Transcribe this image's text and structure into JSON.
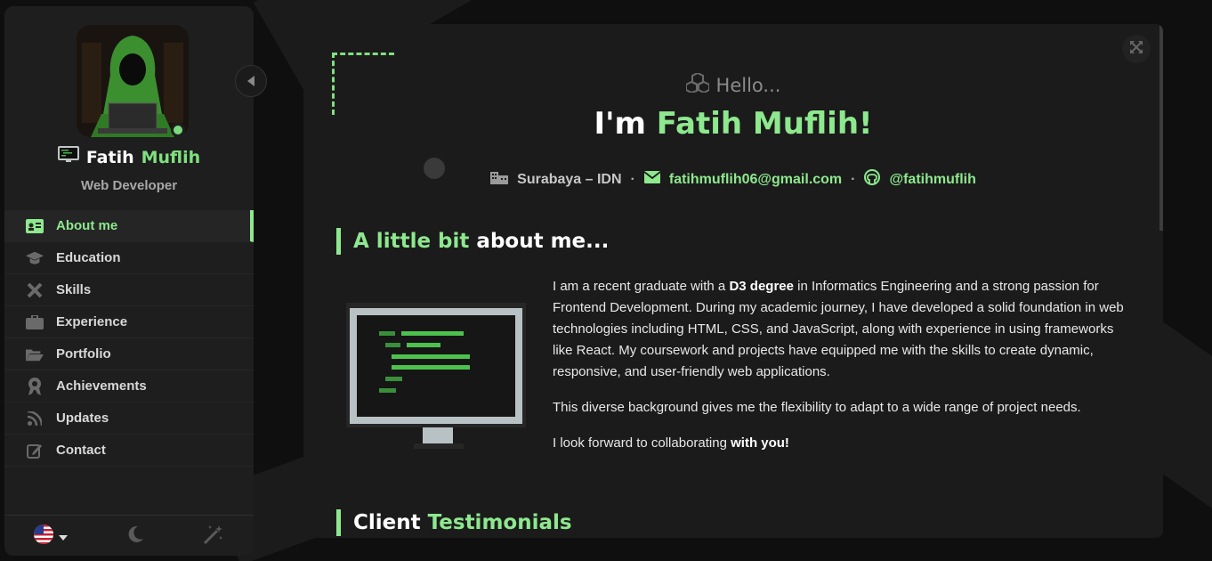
{
  "sidebar": {
    "name_first": "Fatih",
    "name_last": "Muflih",
    "role": "Web Developer",
    "nav": [
      {
        "label": "About me",
        "icon": "id-card-icon",
        "active": true
      },
      {
        "label": "Education",
        "icon": "graduation-cap-icon"
      },
      {
        "label": "Skills",
        "icon": "tools-icon"
      },
      {
        "label": "Experience",
        "icon": "briefcase-icon"
      },
      {
        "label": "Portfolio",
        "icon": "folder-open-icon"
      },
      {
        "label": "Achievements",
        "icon": "award-icon"
      },
      {
        "label": "Updates",
        "icon": "rss-icon"
      },
      {
        "label": "Contact",
        "icon": "edit-icon"
      }
    ],
    "footer": [
      "us-flag-icon",
      "moon-icon",
      "magic-wand-icon"
    ]
  },
  "main": {
    "hello": "Hello...",
    "headline_prefix": "I'm",
    "headline_name": "Fatih Muflih!",
    "location": "Surabaya – IDN",
    "email": "fatihmuflih06@gmail.com",
    "github": "@fatihmuflih",
    "separator": "·",
    "about_title_accent": "A little bit",
    "about_title_rest": "about me...",
    "about_p1_a": "I am a recent graduate with a",
    "about_p1_bold": "D3 degree",
    "about_p1_b": "in Informatics Engineering and a strong passion for Frontend Development. During my academic journey, I have developed a solid foundation in web technologies including HTML, CSS, and JavaScript, along with experience in using frameworks like React. My coursework and projects have equipped me with the skills to create dynamic, responsive, and user-friendly web applications.",
    "about_p2": "This diverse background gives me the flexibility to adapt to a wide range of project needs.",
    "about_p3_a": "I look forward to collaborating",
    "about_p3_bold": "with you!",
    "testimonials_title": "Client",
    "testimonials_accent": "Testimonials"
  },
  "colors": {
    "accent": "#8ee88e",
    "sidebar_bg": "#1e1e1e",
    "main_bg": "#1b1b1b"
  }
}
